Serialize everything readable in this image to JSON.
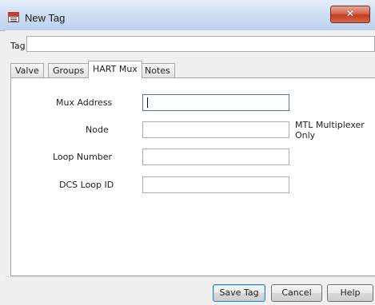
{
  "window": {
    "title": "New Tag",
    "app_icon": "dcm-app-icon",
    "close_glyph": "✕"
  },
  "tag_field": {
    "label": "Tag:",
    "value": ""
  },
  "tabs": [
    {
      "label": "Valve",
      "active": false
    },
    {
      "label": "Groups",
      "active": false
    },
    {
      "label": "HART Mux",
      "active": true
    },
    {
      "label": "Notes",
      "active": false
    }
  ],
  "hart_mux": {
    "mux_address": {
      "label": "Mux Address",
      "value": ""
    },
    "node": {
      "label": "Node",
      "value": "",
      "note": "MTL Multiplexer Only"
    },
    "loop_number": {
      "label": "Loop Number",
      "value": ""
    },
    "dcs_loop_id": {
      "label": "DCS Loop ID",
      "value": ""
    }
  },
  "buttons": {
    "save": "Save Tag",
    "cancel": "Cancel",
    "help": "Help"
  },
  "colors": {
    "title_bar": "#cbdcf2",
    "close_button": "#c23c20",
    "focus_border": "#3d7bad"
  }
}
